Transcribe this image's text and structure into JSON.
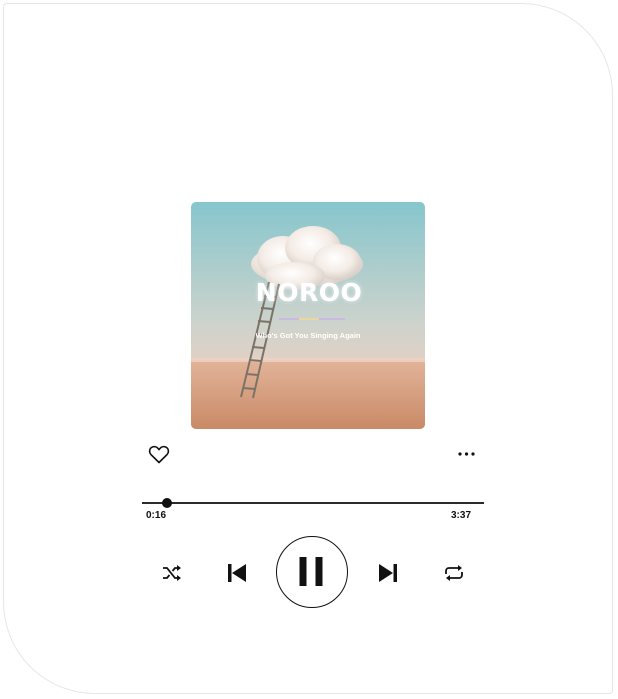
{
  "album": {
    "artist": "NOROO",
    "song_title": "Who's Got You Singing Again",
    "colors": {
      "sky_top": "#8ec9cf",
      "sky_bottom": "#e8c8b8",
      "field": "#d79b78"
    }
  },
  "actions": {
    "like_icon": "heart-outline-icon",
    "more_icon": "ellipsis-icon"
  },
  "playback": {
    "elapsed": "0:16",
    "total": "3:37",
    "progress": 0.0737,
    "state": "playing"
  },
  "controls": {
    "shuffle_icon": "shuffle-icon",
    "previous_icon": "skip-previous-icon",
    "pause_icon": "pause-icon",
    "next_icon": "skip-next-icon",
    "repeat_icon": "repeat-icon"
  }
}
